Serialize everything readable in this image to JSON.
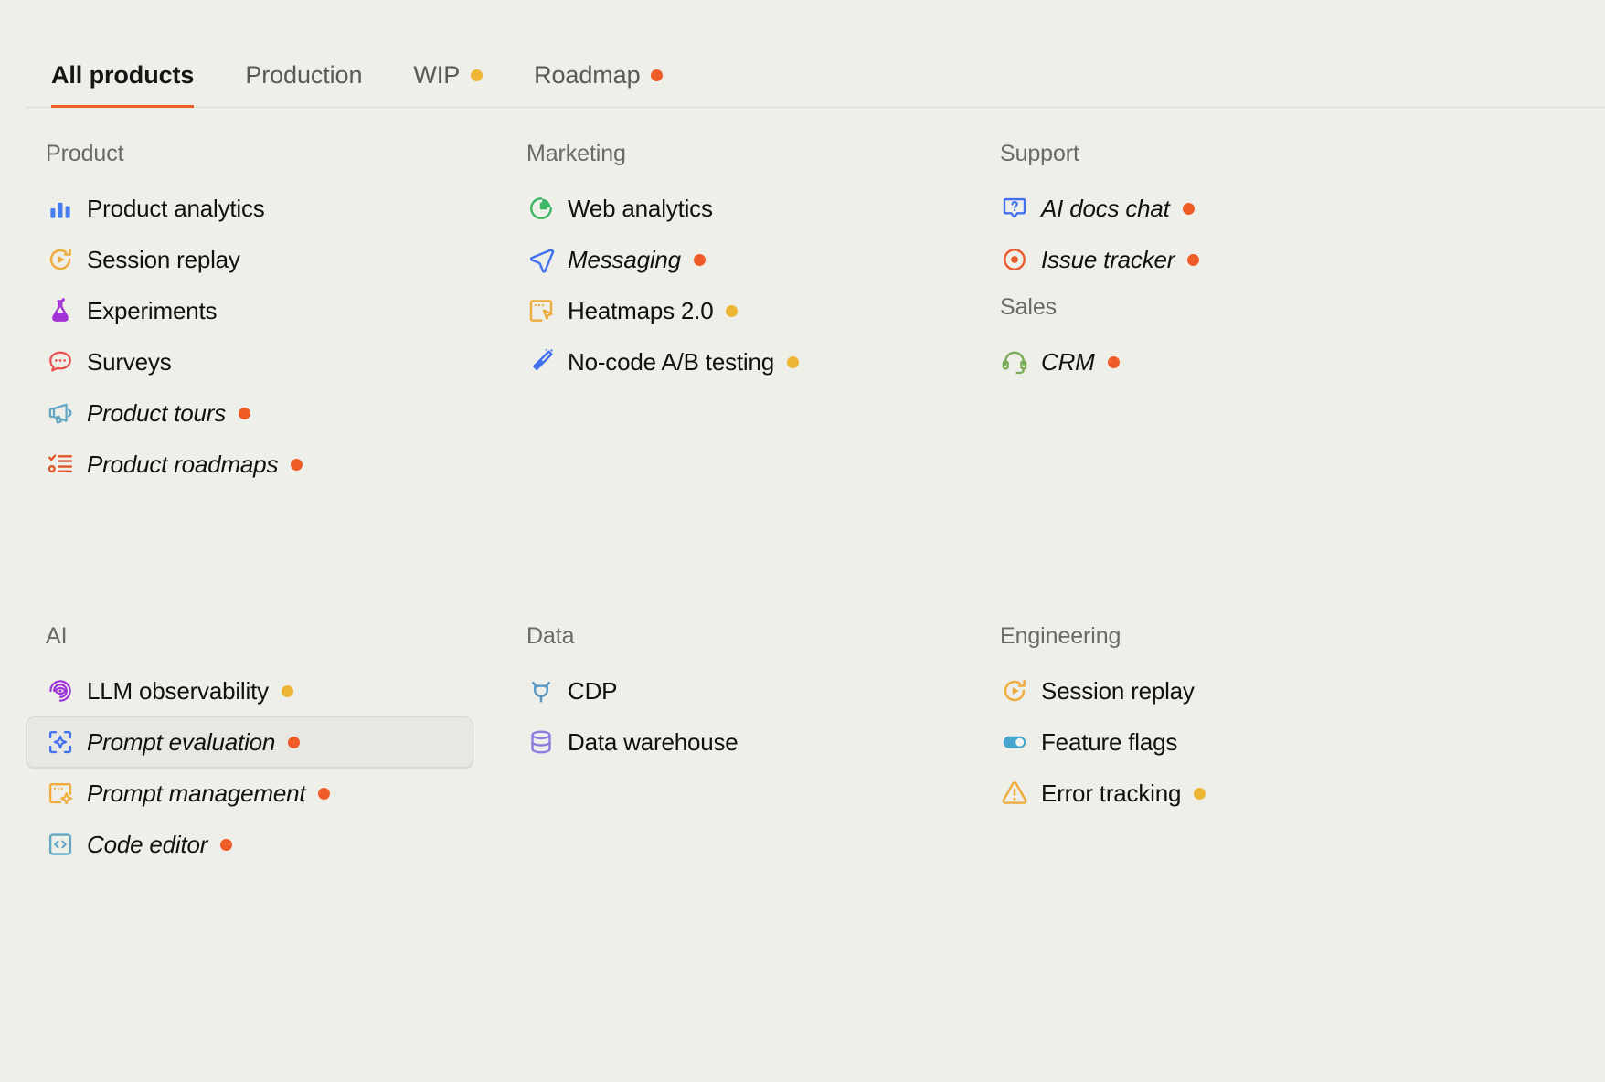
{
  "tabs": [
    {
      "label": "All products",
      "active": true,
      "dot": null
    },
    {
      "label": "Production",
      "active": false,
      "dot": null
    },
    {
      "label": "WIP",
      "active": false,
      "dot": "yellow"
    },
    {
      "label": "Roadmap",
      "active": false,
      "dot": "orange"
    }
  ],
  "colors": {
    "background": "#eeefe9",
    "accent": "#e95f2a",
    "dot_orange": "#ef5c28",
    "dot_yellow": "#eeb635",
    "text": "#111111",
    "muted": "#6a6a64",
    "selected_bg": "#e7e8e1"
  },
  "groups": [
    {
      "title": "Product",
      "column": 1,
      "row": 1,
      "items": [
        {
          "label": "Product analytics",
          "icon": "bar-chart-icon",
          "italic": false,
          "dot": null,
          "selected": false
        },
        {
          "label": "Session replay",
          "icon": "replay-icon",
          "italic": false,
          "dot": null,
          "selected": false
        },
        {
          "label": "Experiments",
          "icon": "flask-icon",
          "italic": false,
          "dot": null,
          "selected": false
        },
        {
          "label": "Surveys",
          "icon": "chat-dots-icon",
          "italic": false,
          "dot": null,
          "selected": false
        },
        {
          "label": "Product tours",
          "icon": "megaphone-icon",
          "italic": true,
          "dot": "orange",
          "selected": false
        },
        {
          "label": "Product roadmaps",
          "icon": "checklist-icon",
          "italic": true,
          "dot": "orange",
          "selected": false
        }
      ]
    },
    {
      "title": "Marketing",
      "column": 2,
      "row": 1,
      "items": [
        {
          "label": "Web analytics",
          "icon": "pie-chart-icon",
          "italic": false,
          "dot": null,
          "selected": false
        },
        {
          "label": "Messaging",
          "icon": "send-icon",
          "italic": true,
          "dot": "orange",
          "selected": false
        },
        {
          "label": "Heatmaps 2.0",
          "icon": "heatmap-icon",
          "italic": false,
          "dot": "yellow",
          "selected": false
        },
        {
          "label": "No-code A/B testing",
          "icon": "wand-icon",
          "italic": false,
          "dot": "yellow",
          "selected": false
        }
      ]
    },
    {
      "title": "Support",
      "column": 3,
      "row": 1,
      "items": [
        {
          "label": "AI docs chat",
          "icon": "question-chat-icon",
          "italic": true,
          "dot": "orange",
          "selected": false
        },
        {
          "label": "Issue tracker",
          "icon": "target-icon",
          "italic": true,
          "dot": "orange",
          "selected": false
        }
      ]
    },
    {
      "title": "Sales",
      "column": 3,
      "row": 1,
      "items": [
        {
          "label": "CRM",
          "icon": "headset-icon",
          "italic": true,
          "dot": "orange",
          "selected": false
        }
      ]
    },
    {
      "title": "AI",
      "column": 1,
      "row": 2,
      "items": [
        {
          "label": "LLM observability",
          "icon": "eye-target-icon",
          "italic": false,
          "dot": "yellow",
          "selected": false
        },
        {
          "label": "Prompt evaluation",
          "icon": "sparkle-box-icon",
          "italic": true,
          "dot": "orange",
          "selected": true
        },
        {
          "label": "Prompt management",
          "icon": "prompt-card-icon",
          "italic": true,
          "dot": "orange",
          "selected": false
        },
        {
          "label": "Code editor",
          "icon": "code-icon",
          "italic": true,
          "dot": "orange",
          "selected": false
        }
      ]
    },
    {
      "title": "Data",
      "column": 2,
      "row": 2,
      "items": [
        {
          "label": "CDP",
          "icon": "plug-icon",
          "italic": false,
          "dot": null,
          "selected": false
        },
        {
          "label": "Data warehouse",
          "icon": "database-icon",
          "italic": false,
          "dot": null,
          "selected": false
        }
      ]
    },
    {
      "title": "Engineering",
      "column": 3,
      "row": 2,
      "items": [
        {
          "label": "Session replay",
          "icon": "replay-icon",
          "italic": false,
          "dot": null,
          "selected": false
        },
        {
          "label": "Feature flags",
          "icon": "toggle-icon",
          "italic": false,
          "dot": null,
          "selected": false
        },
        {
          "label": "Error tracking",
          "icon": "warning-icon",
          "italic": false,
          "dot": "yellow",
          "selected": false
        }
      ]
    }
  ]
}
